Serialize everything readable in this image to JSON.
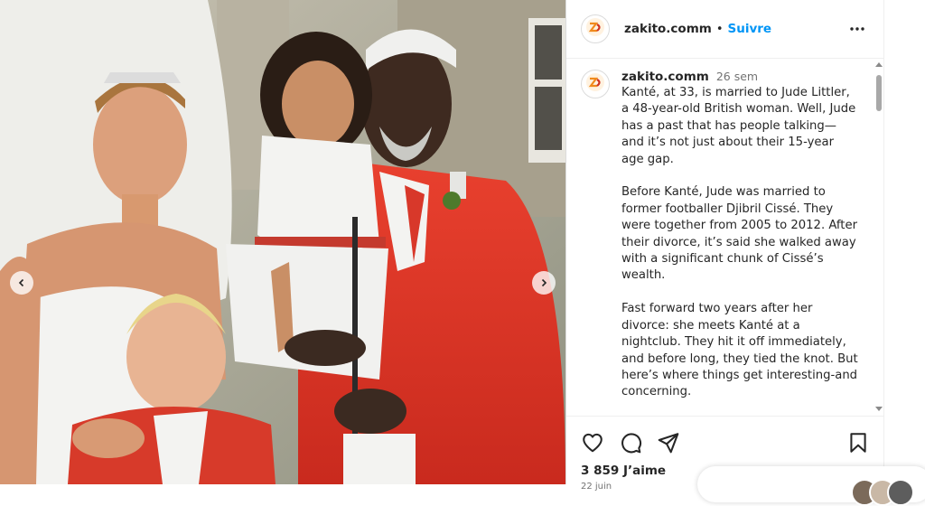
{
  "post": {
    "username": "zakito.comm",
    "follow_label": "Suivre",
    "separator": "•",
    "time_ago": "26 sem",
    "caption": "Kanté, at 33, is married to Jude Littler, a 48-year-old British woman. Well, Jude has a past that has people talking—and it’s not just about their 15-year age gap.\n\nBefore Kanté, Jude was married to former footballer Djibril Cissé. They were together from 2005 to 2012. After their divorce, it’s said she walked away with a significant chunk of Cissé’s wealth.\n\nFast forward two years after her divorce: she meets Kanté at a nightclub. They hit it off immediately, and before long, they tied the knot. But here’s where things get interesting-and concerning.\n\nJude has three children from her",
    "likes": "3 859 J’aime",
    "date_peek": "22 juin"
  },
  "icons": {
    "avatar": "brand-logo-icon",
    "more": "more-options-icon",
    "like": "heart-icon",
    "comment": "comment-icon",
    "share": "share-icon",
    "save": "bookmark-icon",
    "prev": "chevron-left-icon",
    "next": "chevron-right-icon"
  },
  "colors": {
    "accent": "#0095f6",
    "text": "#262626",
    "muted": "#737373",
    "border": "#dbdbdb"
  }
}
